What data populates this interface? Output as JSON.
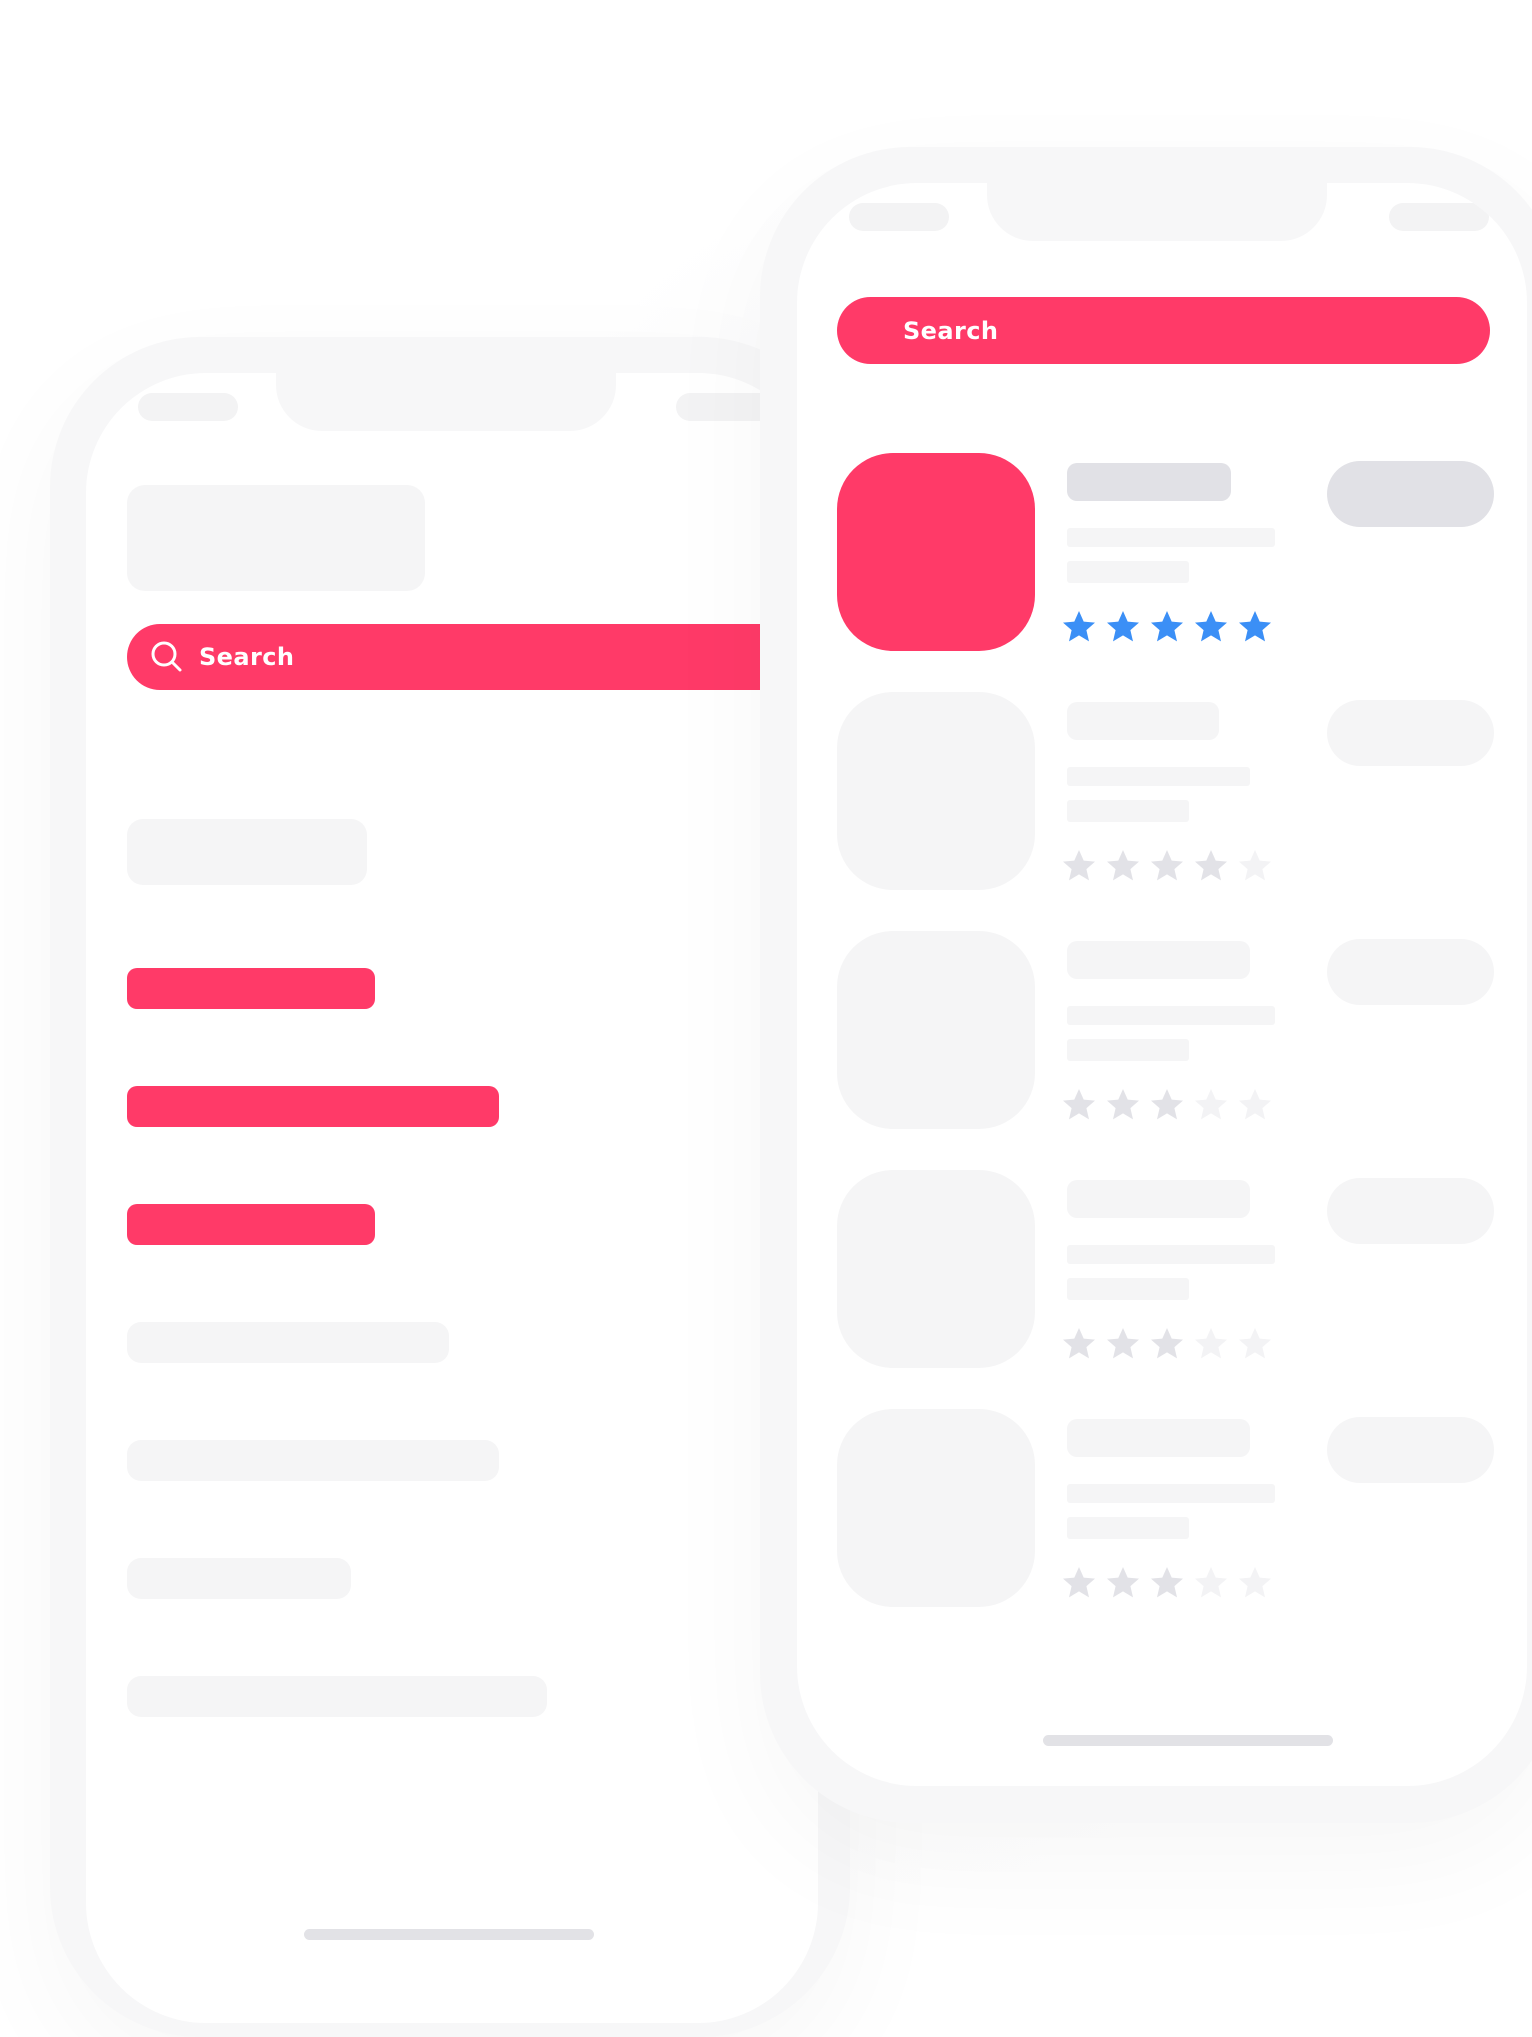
{
  "back_phone": {
    "search": {
      "label": "Search",
      "icon": "search-icon"
    },
    "highlighted_items": [
      {
        "kind": "accent-bar"
      },
      {
        "kind": "accent-bar"
      },
      {
        "kind": "accent-bar"
      }
    ],
    "muted_items": [
      {
        "kind": "skeleton-bar"
      },
      {
        "kind": "skeleton-bar"
      },
      {
        "kind": "skeleton-bar"
      },
      {
        "kind": "skeleton-bar"
      }
    ]
  },
  "front_phone": {
    "search": {
      "label": "Search"
    },
    "app_list": [
      {
        "rating": 5,
        "highlighted": true
      },
      {
        "rating": 4,
        "highlighted": false
      },
      {
        "rating": 3,
        "highlighted": false
      },
      {
        "rating": 3,
        "highlighted": false
      },
      {
        "rating": 3,
        "highlighted": false
      }
    ]
  },
  "colors": {
    "accent": "#ff3a68",
    "star_active": "#3b8ff6",
    "star_muted": "#e2e2e7",
    "star_faint": "#f3f3f5",
    "skeleton": "#f5f5f6",
    "skeleton_strong": "#e1e1e6"
  }
}
